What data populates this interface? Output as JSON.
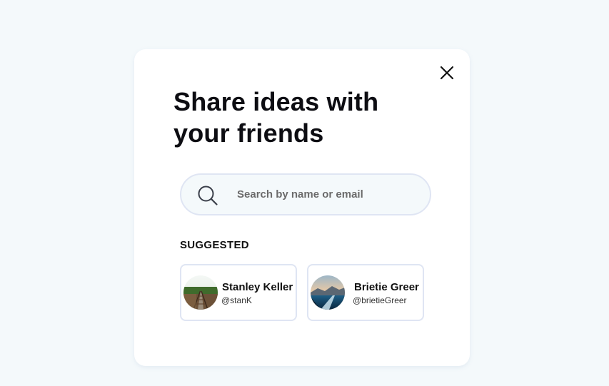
{
  "modal": {
    "title": "Share ideas with your friends",
    "close_icon": "close-icon"
  },
  "search": {
    "icon": "search-icon",
    "placeholder": "Search by name or email",
    "value": ""
  },
  "suggested": {
    "label": "SUGGESTED",
    "users": [
      {
        "name": "Stanley Keller",
        "handle": "@stanK",
        "avatar": "railroad-tracks-photo"
      },
      {
        "name": "Brietie Greer",
        "handle": "@brietieGreer",
        "avatar": "mountain-lake-photo"
      }
    ]
  },
  "colors": {
    "background": "#f4f9fb",
    "card": "#ffffff",
    "border": "#dfe5f3",
    "text": "#0d0d12"
  }
}
